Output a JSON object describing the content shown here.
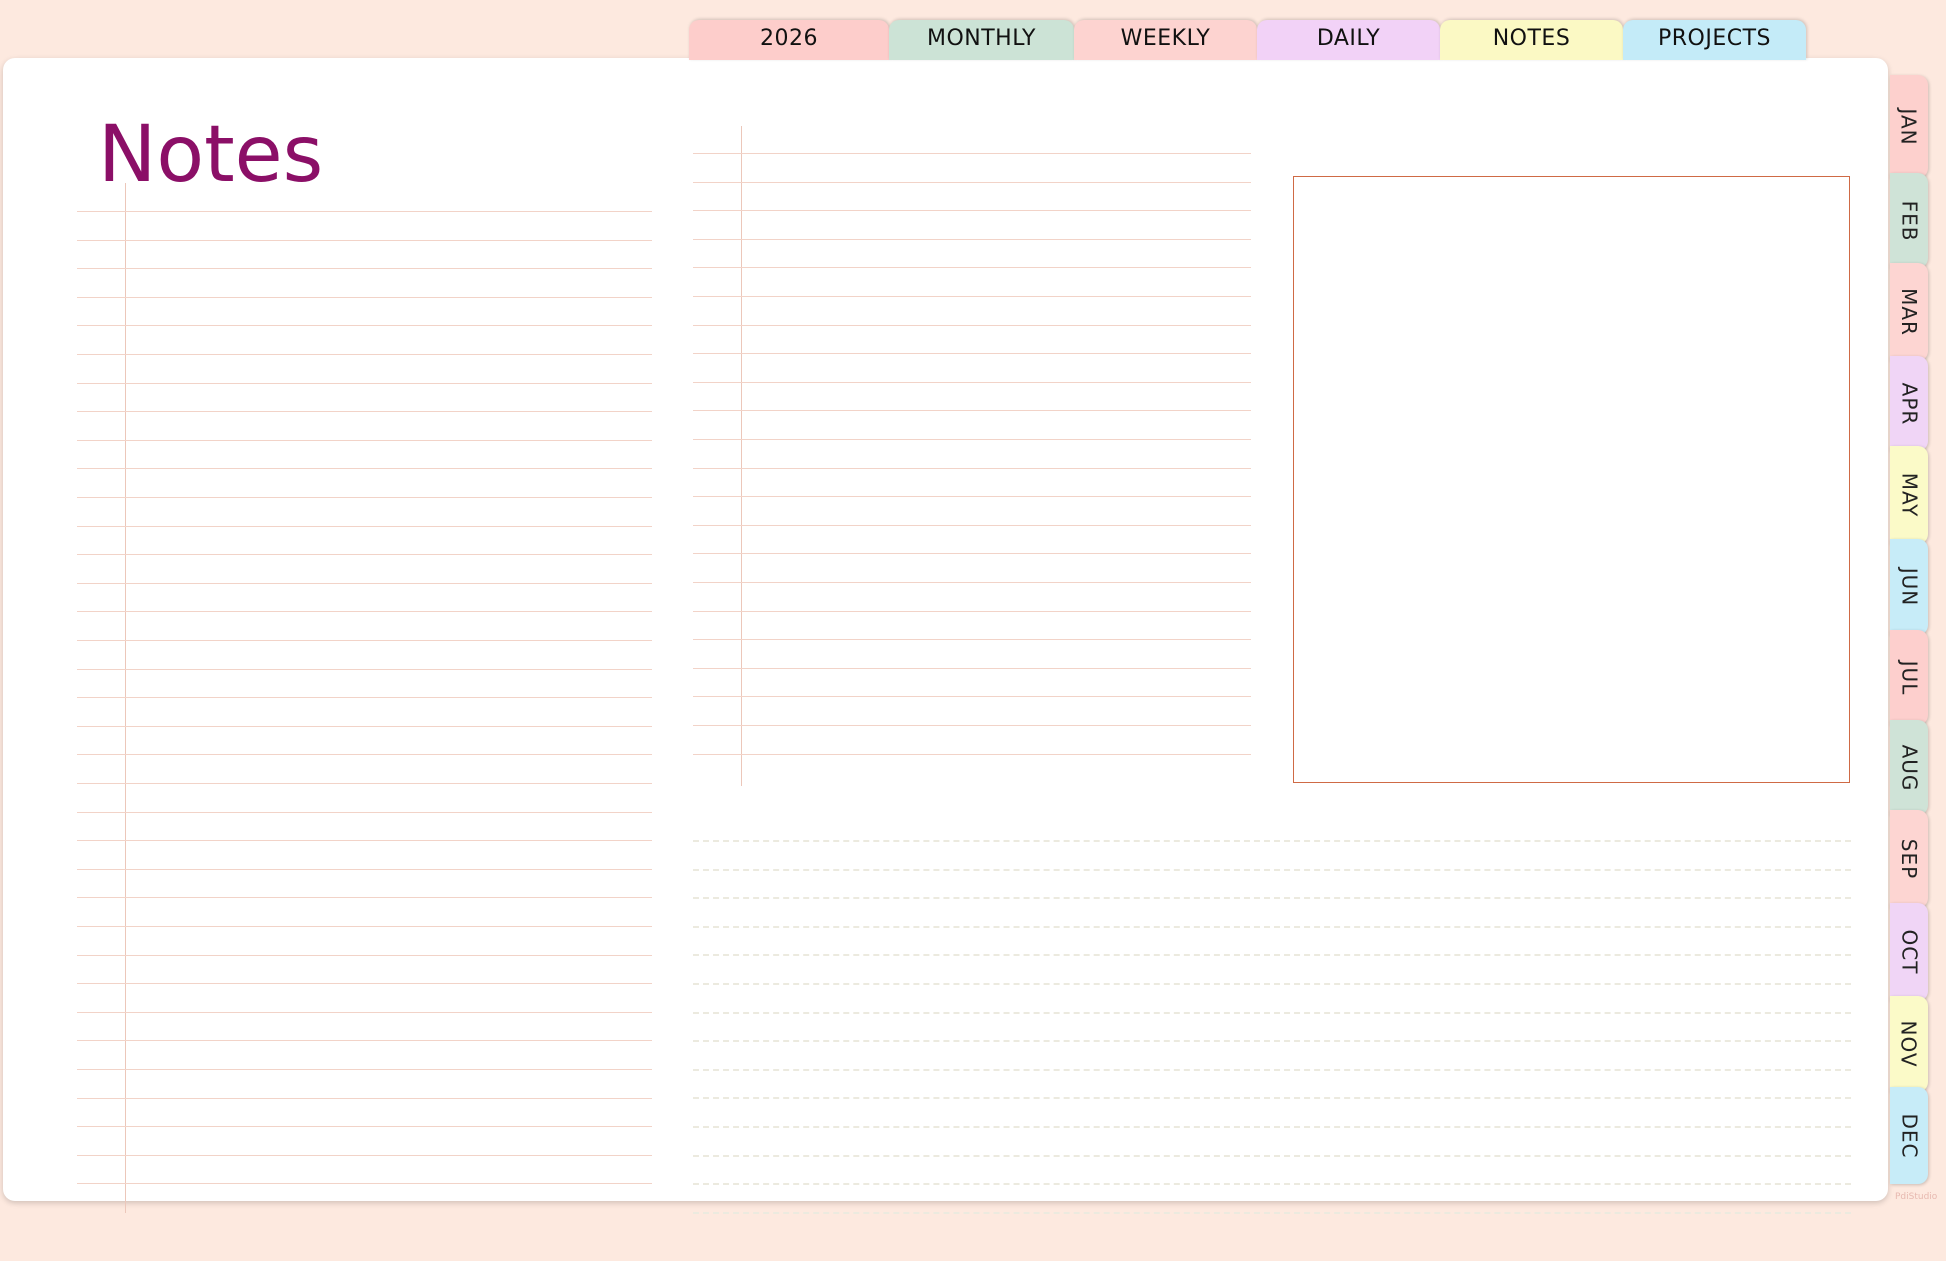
{
  "top_tabs": [
    {
      "label": "2026",
      "color": "#fdcdcb"
    },
    {
      "label": "MONTHLY",
      "color": "#cce3d6"
    },
    {
      "label": "WEEKLY",
      "color": "#fdd3d0"
    },
    {
      "label": "DAILY",
      "color": "#f2d2f7"
    },
    {
      "label": "NOTES",
      "color": "#fbf9c4"
    },
    {
      "label": "PROJECTS",
      "color": "#c4ebf8"
    }
  ],
  "page": {
    "title": "Notes",
    "title_color": "#8b0f67",
    "rule_color": "#f2d3c8",
    "frame_color": "#cf6a45"
  },
  "months": [
    {
      "label": "JAN",
      "color": "#fdd0cd"
    },
    {
      "label": "FEB",
      "color": "#cfe3d7"
    },
    {
      "label": "MAR",
      "color": "#fdd5d2"
    },
    {
      "label": "APR",
      "color": "#f0d5f6"
    },
    {
      "label": "MAY",
      "color": "#fbfac8"
    },
    {
      "label": "JUN",
      "color": "#c7ecf8"
    },
    {
      "label": "JUL",
      "color": "#fdcfcd"
    },
    {
      "label": "AUG",
      "color": "#cfe3d7"
    },
    {
      "label": "SEP",
      "color": "#fdd5d2"
    },
    {
      "label": "OCT",
      "color": "#f0d5f6"
    },
    {
      "label": "NOV",
      "color": "#fbfac8"
    },
    {
      "label": "DEC",
      "color": "#c7ecf8"
    }
  ],
  "watermark": "PdiStudio"
}
